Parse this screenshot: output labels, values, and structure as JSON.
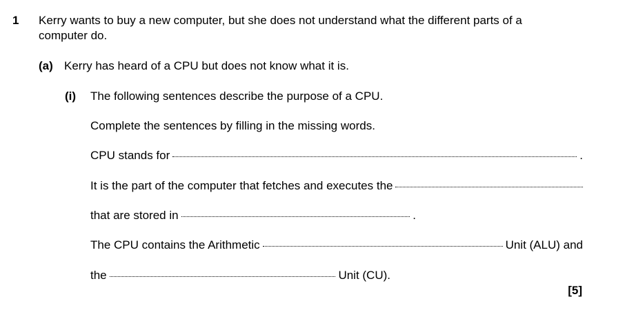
{
  "question": {
    "number": "1",
    "intro_line1": "Kerry wants to buy a new computer, but she does not understand what the different parts of a",
    "intro_line2": "computer do."
  },
  "part_a": {
    "label": "(a)",
    "text": "Kerry has heard of a CPU but does not know what it is."
  },
  "part_i": {
    "label": "(i)",
    "text": "The following sentences describe the purpose of a CPU.",
    "instruction": "Complete the sentences by filling in the missing words."
  },
  "sentences": {
    "s1_before": "CPU stands for",
    "s1_after": ".",
    "s2_before": "It is the part of the computer that fetches and executes the",
    "s3_before": "that are stored in",
    "s3_after": ".",
    "s4_before": "The CPU contains the Arithmetic",
    "s4_after": "Unit (ALU) and",
    "s5_before": "the",
    "s5_after": "Unit (CU)."
  },
  "marks": "[5]"
}
